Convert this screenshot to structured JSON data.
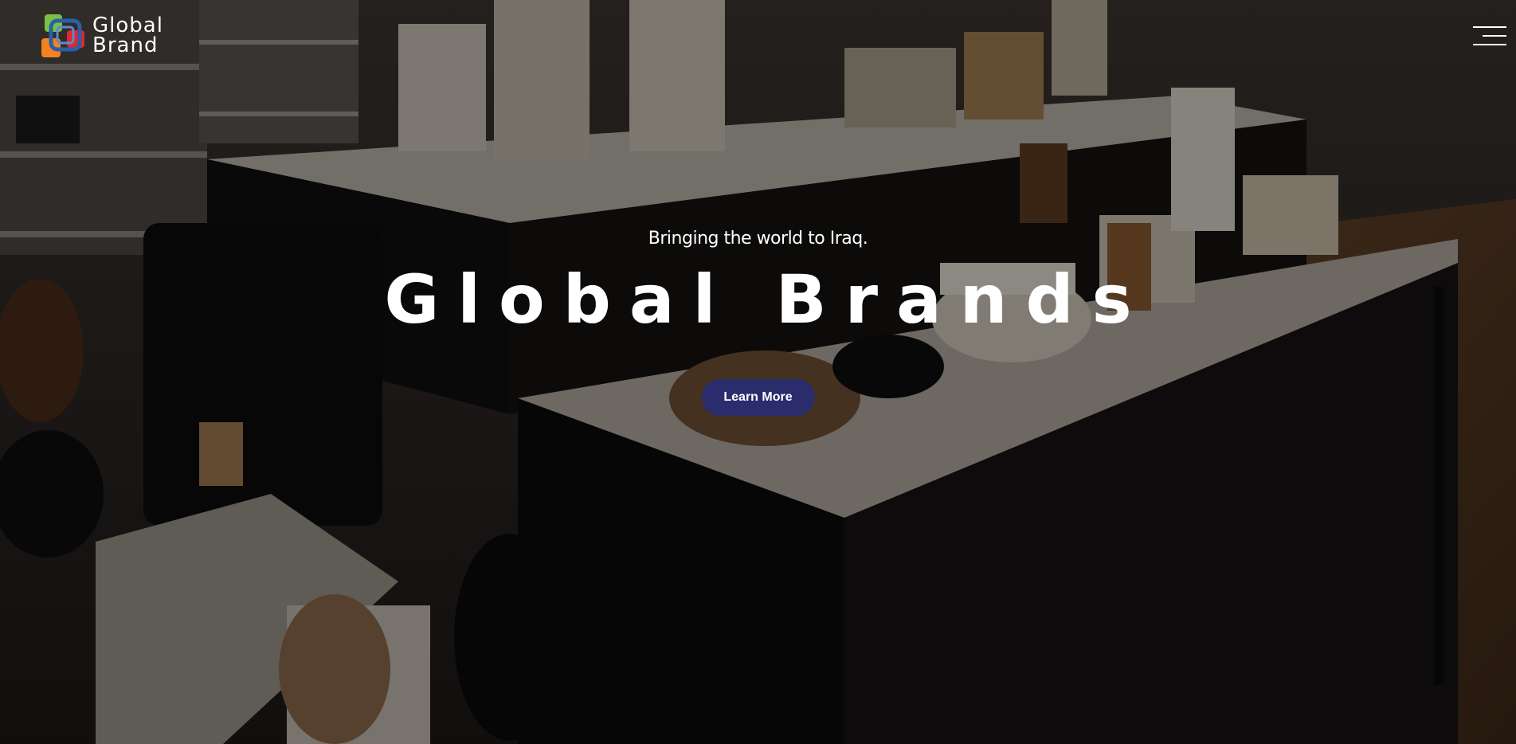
{
  "logo": {
    "line1": "Global",
    "line2": "Brand",
    "icon": "global-brand-logo-icon",
    "colors": [
      "#7ac143",
      "#f58220",
      "#2b5fa8",
      "#e3262f"
    ]
  },
  "nav": {
    "menu_icon": "hamburger-menu-icon"
  },
  "hero": {
    "tagline": "Bringing the world to Iraq.",
    "title": "Global Brands",
    "cta_label": "Learn More",
    "cta_color": "#2b2c6c",
    "background": "store display of shoes and handbags"
  }
}
